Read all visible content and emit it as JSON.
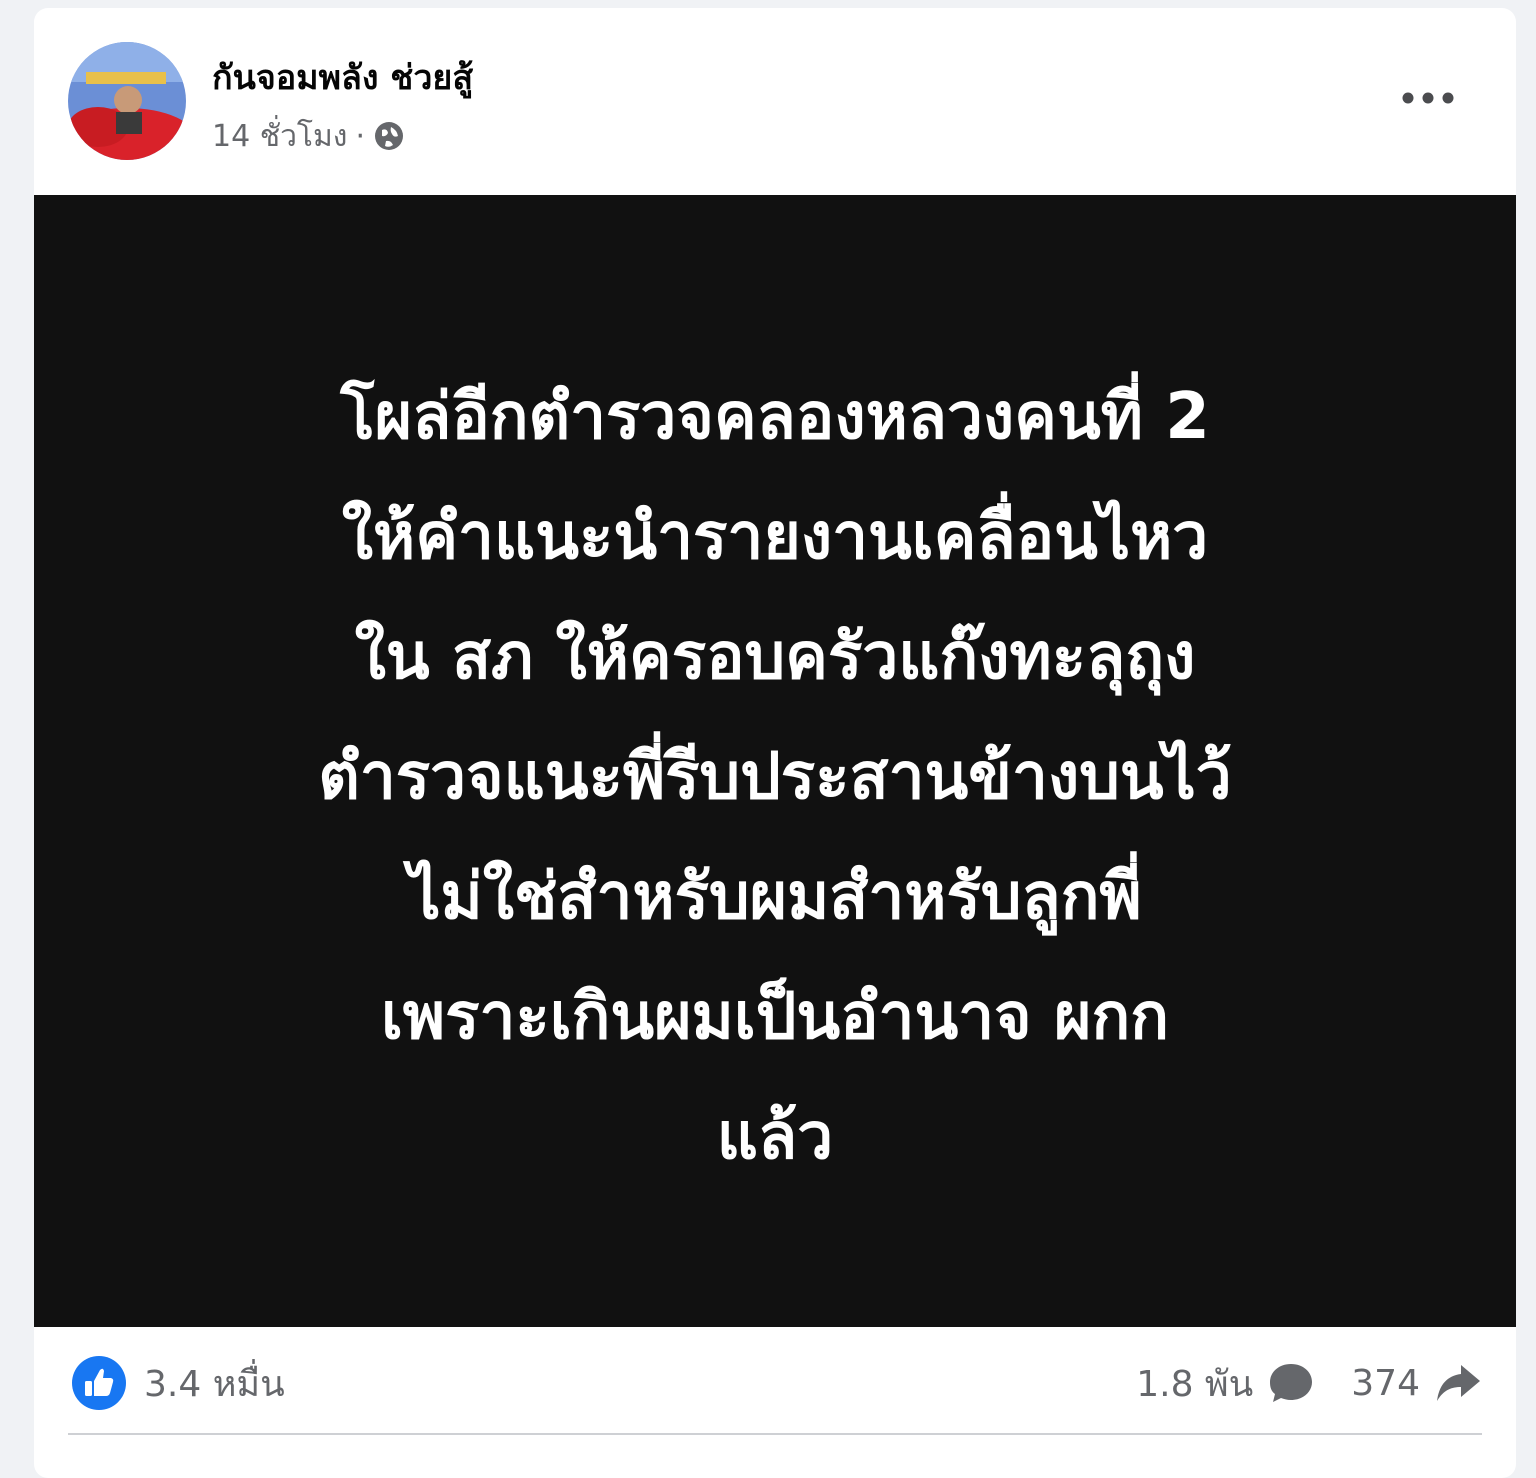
{
  "post": {
    "author_name": "กันจอมพลัง ช่วยสู้",
    "time": "14 ชั่วโมง",
    "separator": "·",
    "privacy_icon": "globe-icon",
    "more_icon": "more-options-icon",
    "image_text_lines": [
      "โผล่อีกตำรวจคลองหลวงคนที่ 2",
      "ให้คำแนะนำรายงานเคลื่อนไหว",
      "ใน สภ ให้ครอบครัวแก๊งทะลุถุง",
      "ตำรวจแนะพี่รีบประสานข้างบนไว้",
      "ไม่ใช่สำหรับผมสำหรับลูกพี่",
      "เพราะเกินผมเป็นอำนาจ ผกก",
      "แล้ว"
    ]
  },
  "stats": {
    "reactions": "3.4 หมื่น",
    "comments": "1.8 พัน",
    "shares": "374",
    "like_icon": "like-reaction-icon",
    "comment_icon": "comment-icon",
    "share_icon": "share-icon"
  },
  "colors": {
    "accent": "#1877f2",
    "image_background": "#111111",
    "meta_text": "#65676b"
  }
}
